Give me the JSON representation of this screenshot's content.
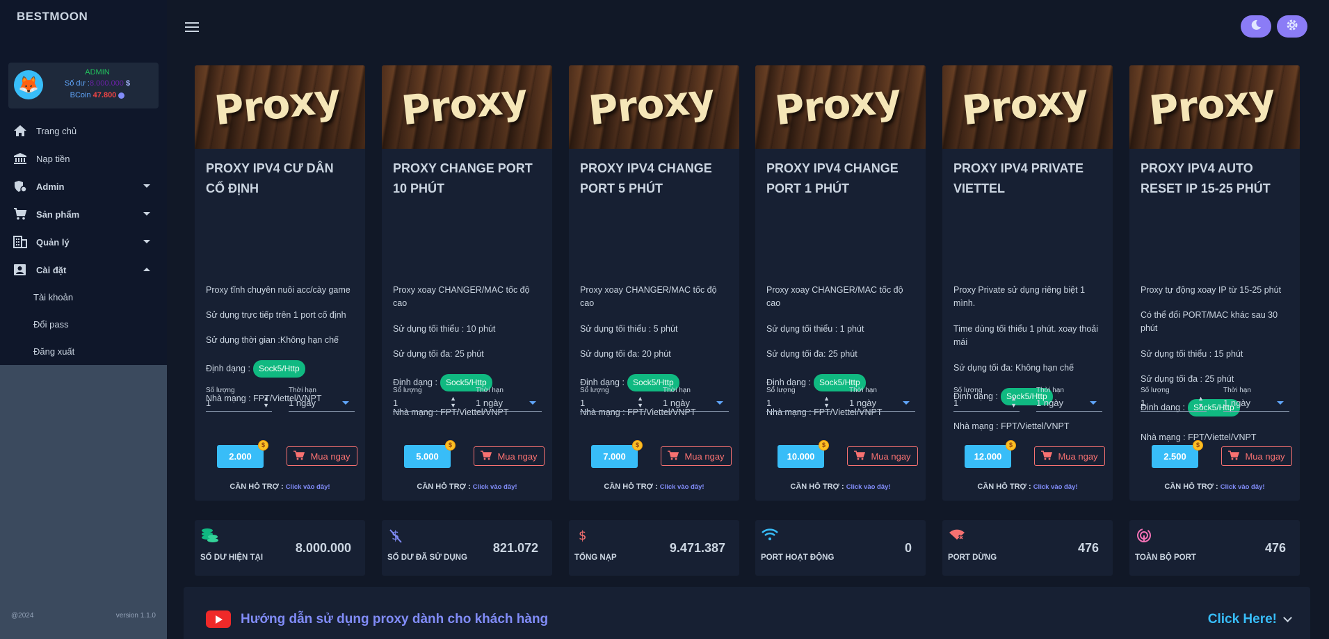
{
  "brand": "BESTMOON",
  "user": {
    "role": "ADMIN",
    "balance_label": "Số dư :",
    "balance_value": "8.000.000",
    "balance_currency": "$",
    "bcoin_label": "BCoin",
    "bcoin_value": "47.800"
  },
  "nav": {
    "home": "Trang chủ",
    "deposit": "Nạp tiền",
    "admin": "Admin",
    "products": "Sản phẩm",
    "manage": "Quản lý",
    "settings": "Cài đặt",
    "account": "Tài khoản",
    "change_pass": "Đổi pass",
    "logout": "Đăng xuất"
  },
  "footer": {
    "copyright": "@2024",
    "version": "version 1.1.0"
  },
  "common": {
    "image_word": "Proxy",
    "qty_label": "Số lượng",
    "term_label": "Thời hạn",
    "buy_label": "Mua ngay",
    "support_label": "CẦN HỖ TRỢ :",
    "support_link": "Click vào đây!"
  },
  "cards": [
    {
      "title": "PROXY IPV4 CƯ DÂN CỐ ĐỊNH",
      "f1": "Proxy tĩnh chuyên nuôi acc/cày game",
      "f2": "Sử dụng trực tiếp trên 1 port cố định",
      "f3": "Sử dụng thời gian :Không hạn chế",
      "format_label": "Định dạng :",
      "format": "Sock5/Http",
      "network": "Nhà mạng : FPT/Viettel/VNPT",
      "qty": "1",
      "term": "1 ngày",
      "price": "2.000"
    },
    {
      "title": "PROXY CHANGE PORT 10 PHÚT",
      "f1": "Proxy xoay CHANGER/MAC tốc độ cao",
      "f2": "Sử dụng tối thiểu : 10 phút",
      "f3": "Sử dụng tối đa: 25 phút",
      "format_label": "Định dạng :",
      "format": "Sock5/Http",
      "network": "Nhà mạng : FPT/Viettel/VNPT",
      "qty": "1",
      "term": "1 ngày",
      "price": "5.000"
    },
    {
      "title": "PROXY IPV4 CHANGE PORT 5 PHÚT",
      "f1": "Proxy xoay CHANGER/MAC tốc độ cao",
      "f2": "Sử dụng tối thiểu : 5 phút",
      "f3": "Sử dụng tối đa: 20 phút",
      "format_label": "Định dạng :",
      "format": "Sock5/Http",
      "network": "Nhà mạng : FPT/Viettel/VNPT",
      "qty": "1",
      "term": "1 ngày",
      "price": "7.000"
    },
    {
      "title": "PROXY IPV4 CHANGE PORT 1 PHÚT",
      "f1": "Proxy xoay CHANGER/MAC tốc độ cao",
      "f2": "Sử dụng tối thiểu : 1 phút",
      "f3": "Sử dụng tối đa: 25 phút",
      "format_label": "Định dạng :",
      "format": "Sock5/Http",
      "network": "Nhà mạng : FPT/Viettel/VNPT",
      "qty": "1",
      "term": "1 ngày",
      "price": "10.000"
    },
    {
      "title": "PROXY IPV4 PRIVATE VIETTEL",
      "f1": "Proxy Private sử dụng riêng biệt 1 mình.",
      "f2": "Time dùng tối thiểu 1 phút. xoay thoải mái",
      "f3": "Sử dụng tối đa: Không hạn chế",
      "format_label": "Định dạng :",
      "format": "Sock5/Http",
      "network": "Nhà mạng : FPT/Viettel/VNPT",
      "qty": "1",
      "term": "1 ngày",
      "price": "12.000"
    },
    {
      "title": "PROXY IPV4 AUTO RESET IP 15-25 PHÚT",
      "f1": "Proxy tự động xoay IP từ 15-25 phút",
      "f2": "Có thể đổi PORT/MAC khác sau 30 phút",
      "f3": "Sử dụng tối thiểu : 15 phút",
      "f4": "Sử dụng tối đa : 25 phút",
      "format_label": "Định dạng :",
      "format": "Sock5/Http",
      "network": "Nhà mạng : FPT/Viettel/VNPT",
      "qty": "1",
      "term": "1 ngày",
      "price": "2.500"
    }
  ],
  "stats": [
    {
      "label": "SỐ DƯ HIỆN TẠI",
      "value": "8.000.000",
      "icon": "coins-icon",
      "color": "#10b981"
    },
    {
      "label": "SỐ DƯ ĐÃ SỬ DỤNG",
      "value": "821.072",
      "icon": "dollar-slash-icon",
      "color": "#818cf8"
    },
    {
      "label": "TỔNG NẠP",
      "value": "9.471.387",
      "icon": "dollar-icon",
      "color": "#f87171"
    },
    {
      "label": "PORT HOẠT ĐỘNG",
      "value": "0",
      "icon": "wifi-icon",
      "color": "#38bdf8"
    },
    {
      "label": "PORT DỪNG",
      "value": "476",
      "icon": "wifi-off-icon",
      "color": "#f87171"
    },
    {
      "label": "TOÀN BỘ PORT",
      "value": "476",
      "icon": "fingerprint-icon",
      "color": "#f472b6"
    }
  ],
  "guide": {
    "text": "Hướng dẫn sử dụng proxy dành cho khách hàng",
    "link": "Click Here!"
  }
}
